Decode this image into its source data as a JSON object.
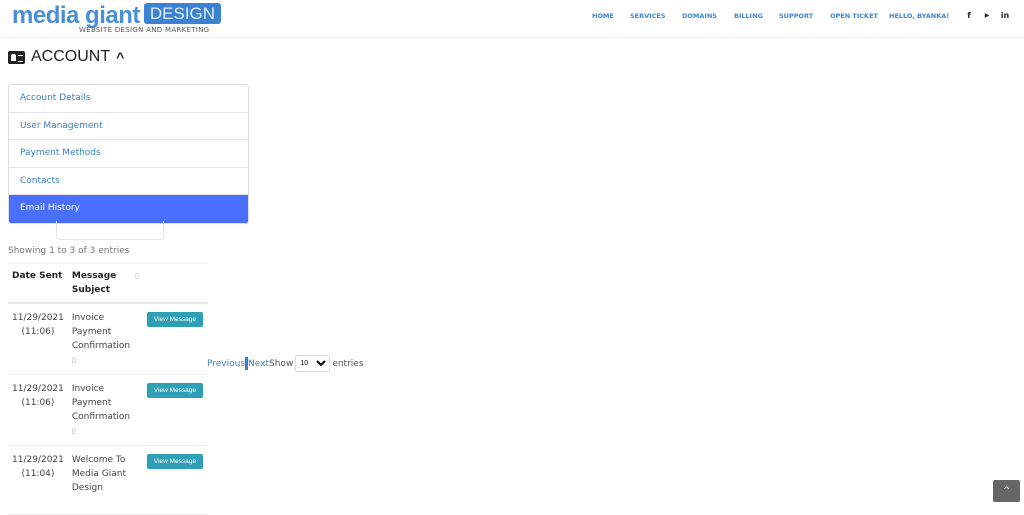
{
  "header": {
    "logo": {
      "main": "media giant",
      "badge": "DESIGN",
      "tagline": "WEBSITE DESIGN AND MARKETING"
    },
    "nav": [
      "HOME",
      "SERVICES",
      "DOMAINS",
      "BILLING",
      "SUPPORT",
      "OPEN TICKET",
      "HELLO, BYANKA!"
    ],
    "social": [
      {
        "icon": "facebook-icon",
        "glyph": "f"
      },
      {
        "icon": "youtube-icon",
        "glyph": "▶"
      },
      {
        "icon": "linkedin-icon",
        "glyph": "in"
      }
    ]
  },
  "account": {
    "title": "ACCOUNT",
    "menu": [
      "Account Details",
      "User Management",
      "Payment Methods",
      "Contacts",
      "Email History"
    ],
    "active": "Email History"
  },
  "table": {
    "info": "Showing 1 to 3 of 3 entries",
    "headers": [
      "Date Sent",
      "Message Subject"
    ],
    "rows": [
      {
        "date": "11/29/2021",
        "time": "(11:06)",
        "subject": "Invoice Payment Confirmation",
        "button": "View Message"
      },
      {
        "date": "11/29/2021",
        "time": "(11:06)",
        "subject": "Invoice Payment Confirmation",
        "button": "View Message"
      },
      {
        "date": "11/29/2021",
        "time": "(11:04)",
        "subject": "Welcome To Media Giant Design",
        "button": "View Message"
      }
    ]
  },
  "pagination": {
    "previous": "Previous",
    "next": "Next",
    "show": "Show",
    "page_size": "10",
    "entries": "entries"
  },
  "colors": {
    "accent": "#4a6ffc",
    "link": "#3a7fc8",
    "button": "#2f9fb5"
  }
}
